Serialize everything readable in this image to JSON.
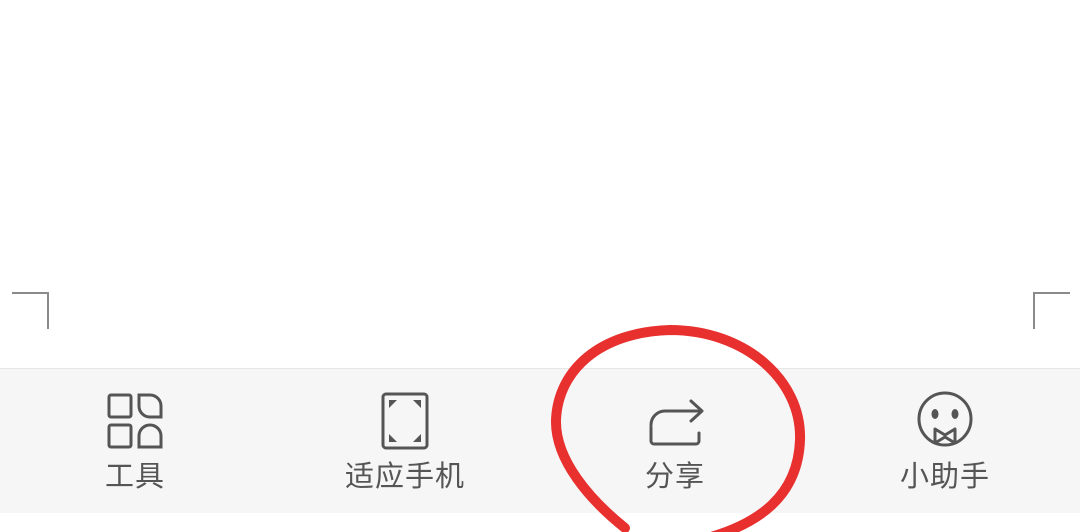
{
  "toolbar": {
    "items": [
      {
        "label": "工具",
        "icon": "tools-grid-icon"
      },
      {
        "label": "适应手机",
        "icon": "fit-screen-icon"
      },
      {
        "label": "分享",
        "icon": "share-arrow-icon"
      },
      {
        "label": "小助手",
        "icon": "assistant-face-icon"
      }
    ]
  },
  "colors": {
    "icon": "#555555",
    "label": "#555555",
    "toolbar_bg": "#f6f6f6",
    "annotation": "#e8302f"
  }
}
